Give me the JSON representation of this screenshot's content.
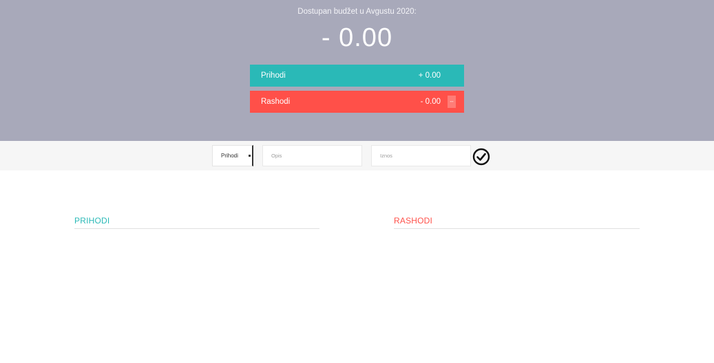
{
  "header": {
    "title": "Dostupan budžet u Avgustu 2020:",
    "budget_value": "- 0.00"
  },
  "summary": {
    "income": {
      "label": "Prihodi",
      "value": "+ 0.00"
    },
    "expense": {
      "label": "Rashodi",
      "value": "- 0.00",
      "percentage": "--"
    }
  },
  "add_form": {
    "type_selected": "Prihodi",
    "description_placeholder": "Opis",
    "value_placeholder": "Iznos",
    "submit_icon": "check-circle-icon"
  },
  "lists": {
    "income_title": "PRIHODI",
    "expense_title": "RASHODI"
  },
  "colors": {
    "header_bg": "#a8a9ba",
    "income": "#2ab9b7",
    "expense": "#ff5049",
    "strip_bg": "#f6f6f6"
  }
}
